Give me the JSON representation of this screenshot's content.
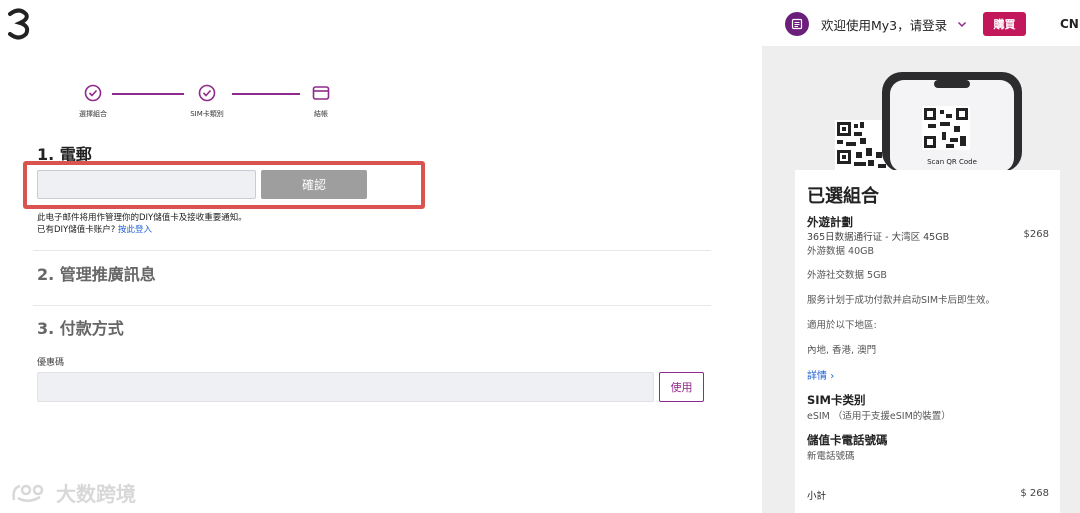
{
  "header": {
    "logo_icon": "three-logo-icon",
    "user_icon": "user-card-icon",
    "welcome_text": "欢迎使用My3，请登录",
    "buy_label": "購買",
    "lang_label": "CN"
  },
  "steps": [
    {
      "label": "選擇組合",
      "icon": "check-circle-icon"
    },
    {
      "label": "SIM卡類別",
      "icon": "check-circle-icon"
    },
    {
      "label": "結帳",
      "icon": "card-icon"
    }
  ],
  "email_section": {
    "title": "1. 電郵",
    "confirm_label": "確認",
    "note_line1": "此电子邮件将用作管理你的DIY儲值卡及接收重要通知。",
    "note_line2": "已有DIY儲值卡账户?",
    "login_link": "按此登入"
  },
  "promo_section": {
    "title": "2. 管理推廣訊息"
  },
  "payment_section": {
    "title": "3. 付款方式",
    "coupon_label": "優惠碼",
    "use_label": "使用"
  },
  "watermark": "大数跨境",
  "summary": {
    "title": "已選組合",
    "plan_heading": "外遊計劃",
    "plan_name": "365日数据通行证 - 大湾区 45GB",
    "plan_price": "$268",
    "data_line": "外游数据 40GB",
    "social_line": "外游社交数据 5GB",
    "service_line": "服务计划于成功付款并启动SIM卡后即生效。",
    "area_heading": "適用於以下地區:",
    "areas": "內地, 香港, 澳門",
    "details_link": "詳情",
    "sim_heading": "SIM卡类别",
    "sim_value": "eSIM （适用于支援eSIM的裝置）",
    "number_heading": "儲值卡電話號碼",
    "number_value": "新電話號碼",
    "subtotal_label": "小計",
    "subtotal_value": "$ 268"
  },
  "phone": {
    "scan_text": "Scan QR Code"
  },
  "colors": {
    "brand": "#8e2a8b",
    "buy": "#c2185b",
    "highlight": "#d9534f",
    "link": "#1e5fd0"
  }
}
